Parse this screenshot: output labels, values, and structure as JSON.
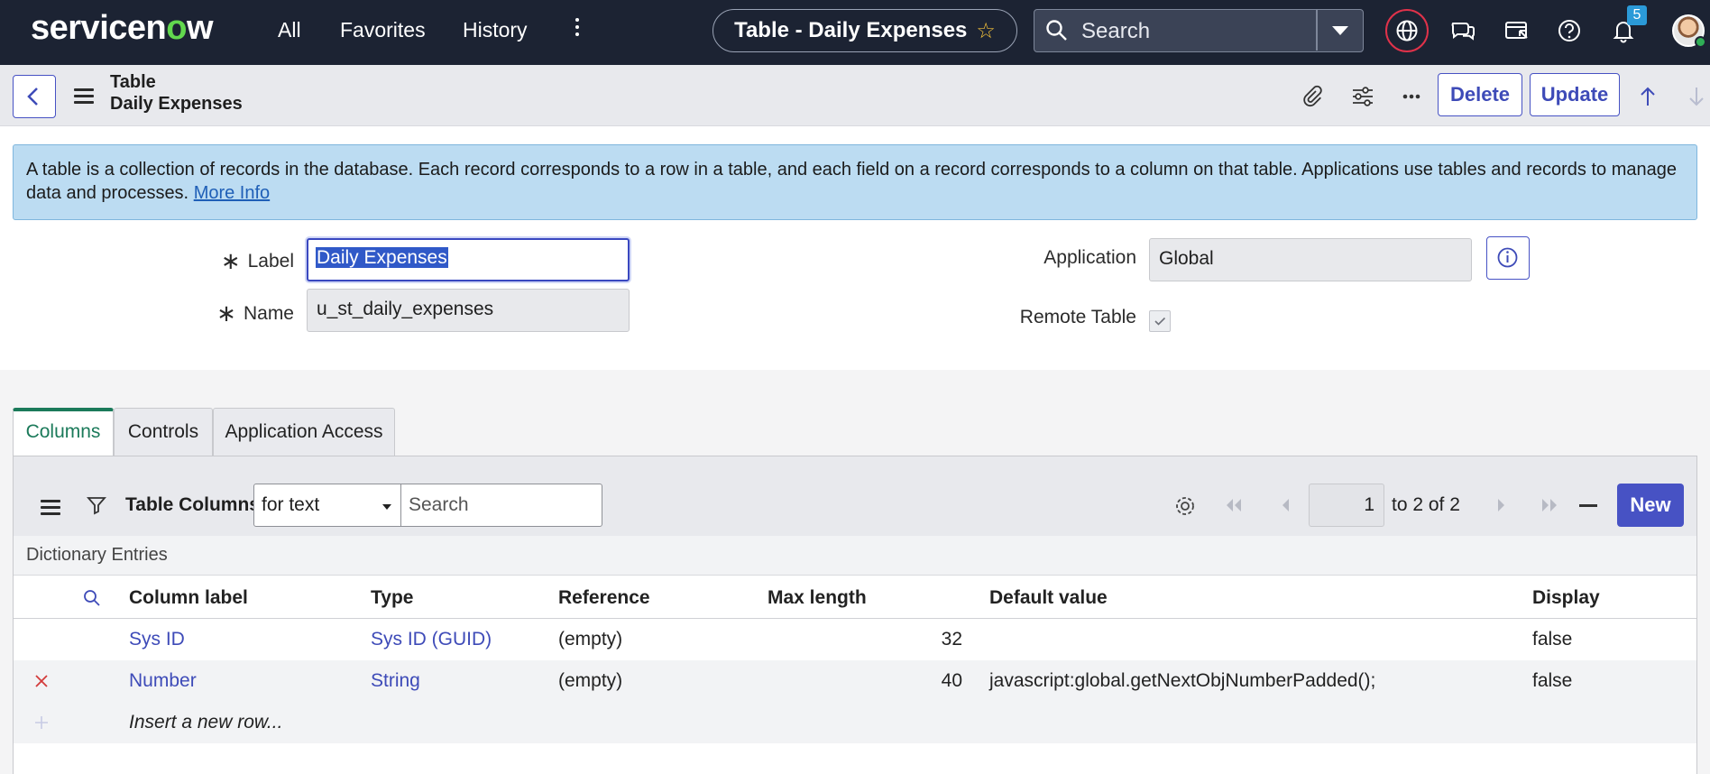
{
  "topnav": {
    "logo_left": "servicen",
    "logo_o": "o",
    "logo_right": "w",
    "links": [
      "All",
      "Favorites",
      "History"
    ],
    "title": "Table - Daily Expenses",
    "search_placeholder": "Search",
    "notification_count": "5"
  },
  "header": {
    "line1": "Table",
    "line2": "Daily Expenses",
    "delete_label": "Delete",
    "update_label": "Update"
  },
  "info": {
    "text": "A table is a collection of records in the database. Each record corresponds to a row in a table, and each field on a record corresponds to a column on that table. Applications use tables and records to manage data and processes.",
    "link": "More Info"
  },
  "form": {
    "label_label": "Label",
    "label_value": "Daily Expenses",
    "name_label": "Name",
    "name_value": "u_st_daily_expenses",
    "application_label": "Application",
    "application_value": "Global",
    "remote_label": "Remote Table"
  },
  "tabs": [
    "Columns",
    "Controls",
    "Application Access"
  ],
  "list": {
    "title": "Table Columns",
    "filter_select": "for text",
    "search_placeholder": "Search",
    "page_value": "1",
    "page_text": "to 2 of 2",
    "new_label": "New",
    "breadcrumb": "Dictionary Entries",
    "columns": [
      "Column label",
      "Type",
      "Reference",
      "Max length",
      "Default value",
      "Display"
    ],
    "rows": [
      {
        "label": "Sys ID",
        "type": "Sys ID (GUID)",
        "reference": "(empty)",
        "max_length": "32",
        "default": "",
        "display": "false"
      },
      {
        "label": "Number",
        "type": "String",
        "reference": "(empty)",
        "max_length": "40",
        "default": "javascript:global.getNextObjNumberPadded();",
        "display": "false"
      }
    ],
    "insert_row": "Insert a new row..."
  },
  "colors": {
    "nav_bg": "#1c2333",
    "accent": "#4752c4",
    "tab_active": "#1b7a5a",
    "info_bg": "#bcdcf2"
  }
}
